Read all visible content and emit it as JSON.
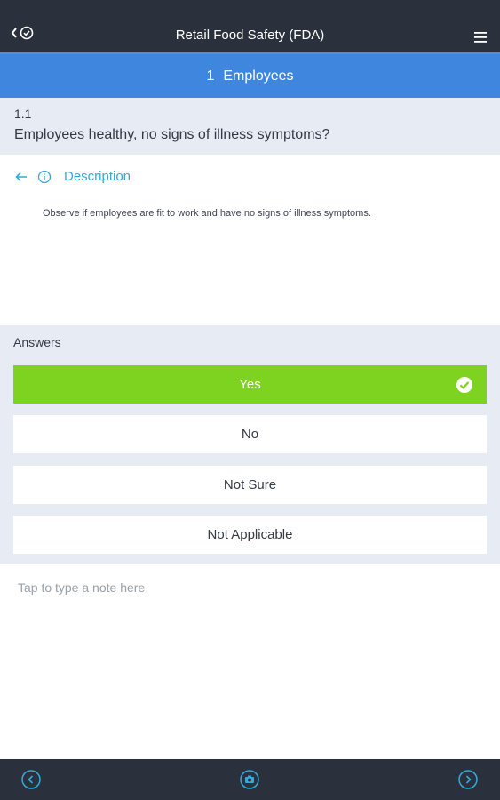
{
  "header": {
    "title": "Retail Food Safety (FDA)",
    "back_icon": "back-check-icon",
    "menu_icon": "hamburger-menu-icon"
  },
  "section": {
    "number": "1",
    "name": "Employees"
  },
  "question": {
    "number": "1.1",
    "text": "Employees healthy, no signs of illness symptoms?"
  },
  "description": {
    "label": "Description",
    "text": "Observe if employees are fit to work and have no signs of illness symptoms."
  },
  "answers": {
    "label": "Answers",
    "options": [
      {
        "label": "Yes",
        "selected": true
      },
      {
        "label": "No",
        "selected": false
      },
      {
        "label": "Not Sure",
        "selected": false
      },
      {
        "label": "Not Applicable",
        "selected": false
      }
    ]
  },
  "note": {
    "placeholder": "Tap to type a note here"
  },
  "colors": {
    "header_bg": "#2a313c",
    "section_bg": "#3e86de",
    "accent_link": "#35a9d9",
    "selected_answer": "#7ed321",
    "panel_bg": "#e7ebf4"
  }
}
